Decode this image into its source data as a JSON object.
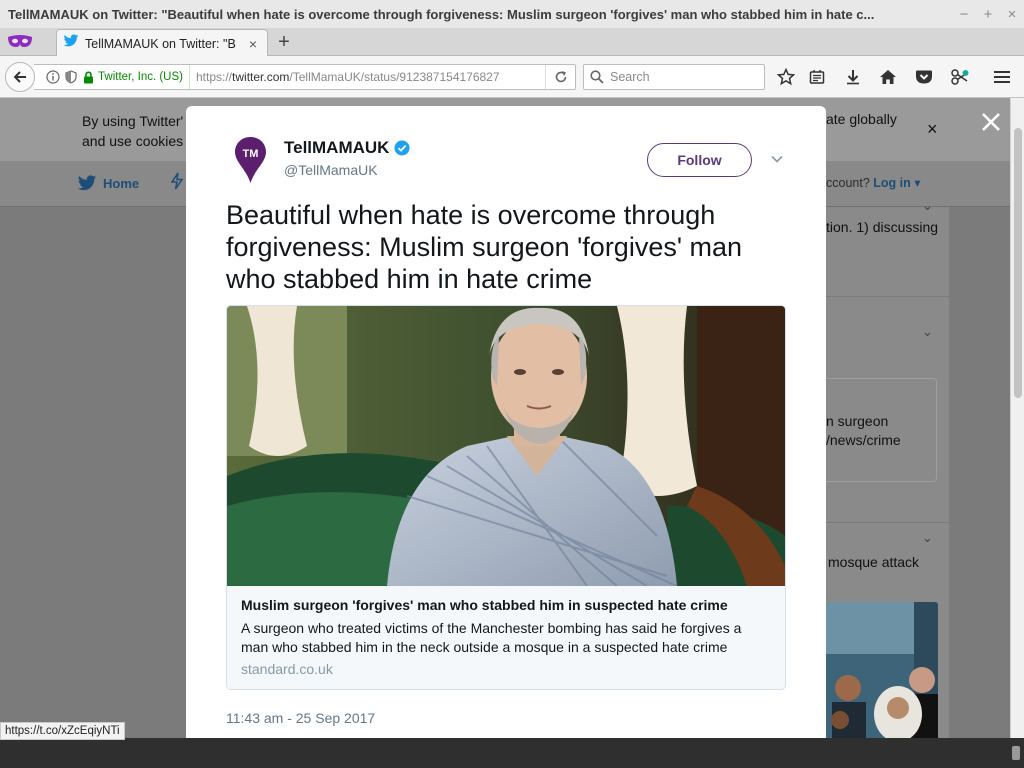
{
  "window": {
    "title": "TellMAMAUK on Twitter: \"Beautiful when hate is overcome through forgiveness: Muslim surgeon 'forgives' man who stabbed him in hate c...",
    "minimize": "−",
    "maximize": "+",
    "close": "×"
  },
  "tabs": [
    {
      "title": "TellMAMAUK on Twitter: \"B",
      "close": "×"
    }
  ],
  "new_tab_label": "+",
  "urlbar": {
    "organization": "Twitter, Inc. (US)",
    "url_prefix": "https://",
    "url_host": "twitter.com",
    "url_path": "/TellMamaUK/status/912387154176827"
  },
  "search": {
    "placeholder": "Search"
  },
  "page": {
    "cookie_text_line1": "By using Twitter'",
    "cookie_text_line2": "and use cookies",
    "cookie_text_right": "ate globally",
    "cookie_close": "×",
    "nav_home": "Home",
    "nav_account": "ccount?",
    "nav_login": "Log in",
    "side_text_1": "tion. 1) discussing",
    "side_text_2": "n surgeon",
    "side_text_3": "/news/crime",
    "side_text_4": "mosque attack"
  },
  "tweet": {
    "display_name": "TellMAMAUK",
    "handle": "@TellMamaUK",
    "follow_label": "Follow",
    "avatar_text": "TM",
    "text": "Beautiful when hate is overcome through forgiveness: Muslim surgeon 'forgives' man who stabbed him in hate crime",
    "card": {
      "title": "Muslim surgeon 'forgives' man who stabbed him in suspected hate crime",
      "description": "A surgeon who treated victims of the Manchester bombing has said he forgives a man who stabbed him in the neck outside a mosque in a suspected hate crime",
      "domain": "standard.co.uk"
    },
    "timestamp": "11:43 am - 25 Sep 2017"
  },
  "status_bar": {
    "link": "https://t.co/xZcEqiyNTi"
  },
  "colors": {
    "brand_purple": "#5b3a7a",
    "twitter_blue": "#1da1f2",
    "overlay_gray": "#7b7b7b",
    "secure_green": "#058b00"
  },
  "icons": [
    "mask-icon",
    "twitter-bird-icon",
    "back-arrow-icon",
    "info-icon",
    "shield-icon",
    "lock-icon",
    "reload-icon",
    "search-icon",
    "star-icon",
    "reading-list-icon",
    "download-icon",
    "home-icon",
    "pocket-icon",
    "extension-icon",
    "menu-icon",
    "verified-icon",
    "chevron-down-icon",
    "close-icon"
  ]
}
